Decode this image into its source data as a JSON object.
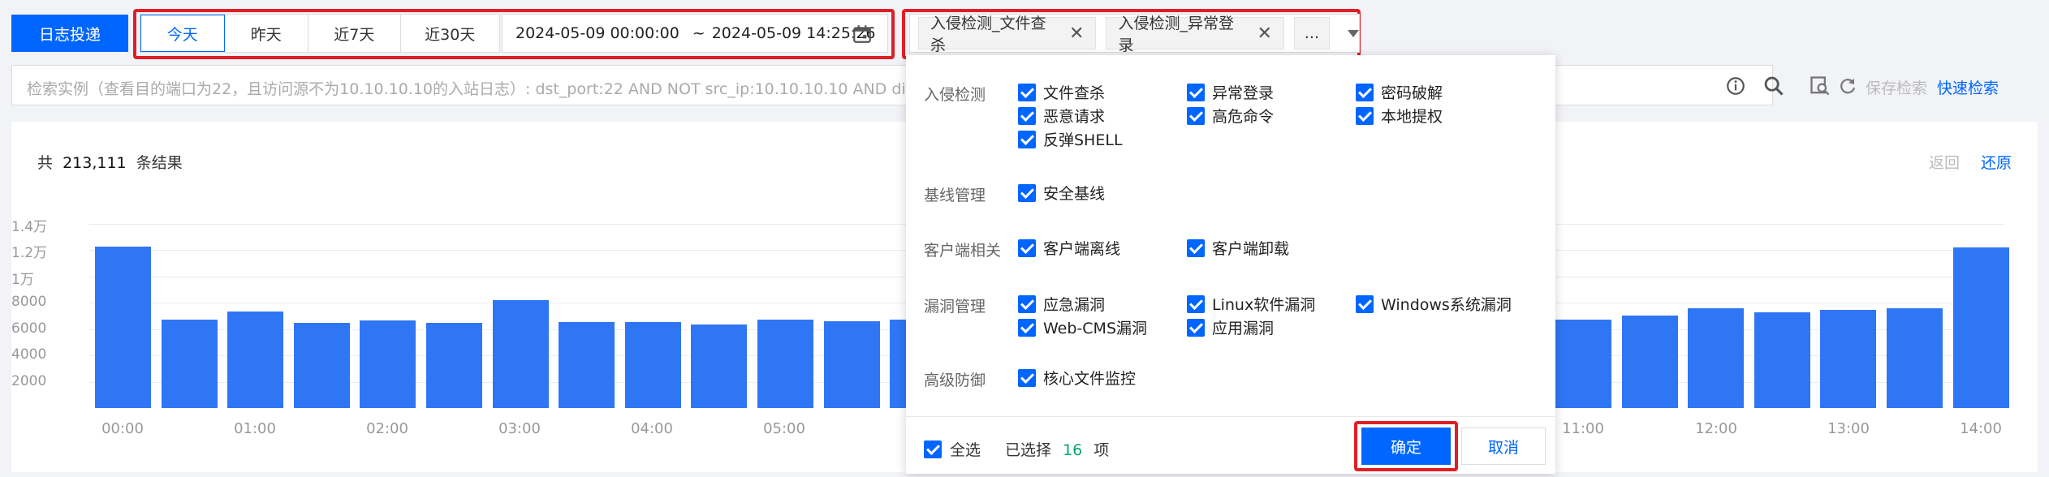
{
  "toolbar": {
    "log_delivery_label": "日志投递",
    "time_tabs": [
      "今天",
      "昨天",
      "近7天",
      "近30天"
    ],
    "active_tab_index": 0,
    "date_start": "2024-05-09 00:00:00",
    "date_sep": "~",
    "date_end": "2024-05-09 14:25:26"
  },
  "filter_tags": [
    {
      "label": "入侵检测_文件查杀"
    },
    {
      "label": "入侵检测_异常登录"
    }
  ],
  "filter_more": "...",
  "search": {
    "placeholder": "检索实例（查看目的端口为22，且访问源不为10.10.10.10的入站日志）: dst_port:22 AND NOT src_ip:10.10.10.10 AND direction",
    "save_search_label": "保存检索",
    "quick_search_label": "快速检索"
  },
  "result": {
    "prefix": "共",
    "count": "213,111",
    "suffix": "条结果",
    "back_label": "返回",
    "restore_label": "还原"
  },
  "dropdown": {
    "groups": [
      {
        "title": "入侵检测",
        "options": [
          "文件查杀",
          "异常登录",
          "密码破解",
          "恶意请求",
          "高危命令",
          "本地提权",
          "反弹SHELL"
        ]
      },
      {
        "title": "基线管理",
        "options": [
          "安全基线"
        ]
      },
      {
        "title": "客户端相关",
        "options": [
          "客户端离线",
          "客户端卸载"
        ]
      },
      {
        "title": "漏洞管理",
        "options": [
          "应急漏洞",
          "Linux软件漏洞",
          "Windows系统漏洞",
          "Web-CMS漏洞",
          "应用漏洞"
        ]
      },
      {
        "title": "高级防御",
        "options": [
          "核心文件监控"
        ]
      }
    ],
    "select_all_label": "全选",
    "selected_prefix": "已选择",
    "selected_count": "16",
    "selected_suffix": "项",
    "confirm_label": "确定",
    "cancel_label": "取消"
  },
  "colors": {
    "primary": "#0066ff",
    "bar": "#2f76f5",
    "highlight": "#e01e25",
    "count_green": "#00a870"
  },
  "chart_data": {
    "type": "bar",
    "y_ticks": [
      "1.4万",
      "1.2万",
      "1万",
      "8000",
      "6000",
      "4000",
      "2000"
    ],
    "y_tick_values": [
      14000,
      12000,
      10000,
      8000,
      6000,
      4000,
      2000
    ],
    "ylim": [
      0,
      14500
    ],
    "x_ticks": [
      "00:00",
      "01:00",
      "02:00",
      "03:00",
      "04:00",
      "05:00",
      "11:00",
      "12:00",
      "13:00",
      "14:00"
    ],
    "left_bars": [
      {
        "time": "00:00",
        "value": 12300
      },
      {
        "time": "00:30",
        "value": 6750
      },
      {
        "time": "01:00",
        "value": 7350
      },
      {
        "time": "01:30",
        "value": 6500
      },
      {
        "time": "02:00",
        "value": 6650
      },
      {
        "time": "02:30",
        "value": 6450
      },
      {
        "time": "03:00",
        "value": 8200
      },
      {
        "time": "03:30",
        "value": 6550
      },
      {
        "time": "04:00",
        "value": 6550
      },
      {
        "time": "04:30",
        "value": 6350
      },
      {
        "time": "05:00",
        "value": 6750
      },
      {
        "time": "05:30",
        "value": 6600
      },
      {
        "time": "06:00",
        "value": 6750
      }
    ],
    "right_bars": [
      {
        "time": "11:00",
        "value": 6700
      },
      {
        "time": "11:30",
        "value": 7050
      },
      {
        "time": "12:00",
        "value": 7600
      },
      {
        "time": "12:30",
        "value": 7300
      },
      {
        "time": "13:00",
        "value": 7450
      },
      {
        "time": "13:30",
        "value": 7600
      },
      {
        "time": "14:00",
        "value": 12200
      }
    ]
  }
}
